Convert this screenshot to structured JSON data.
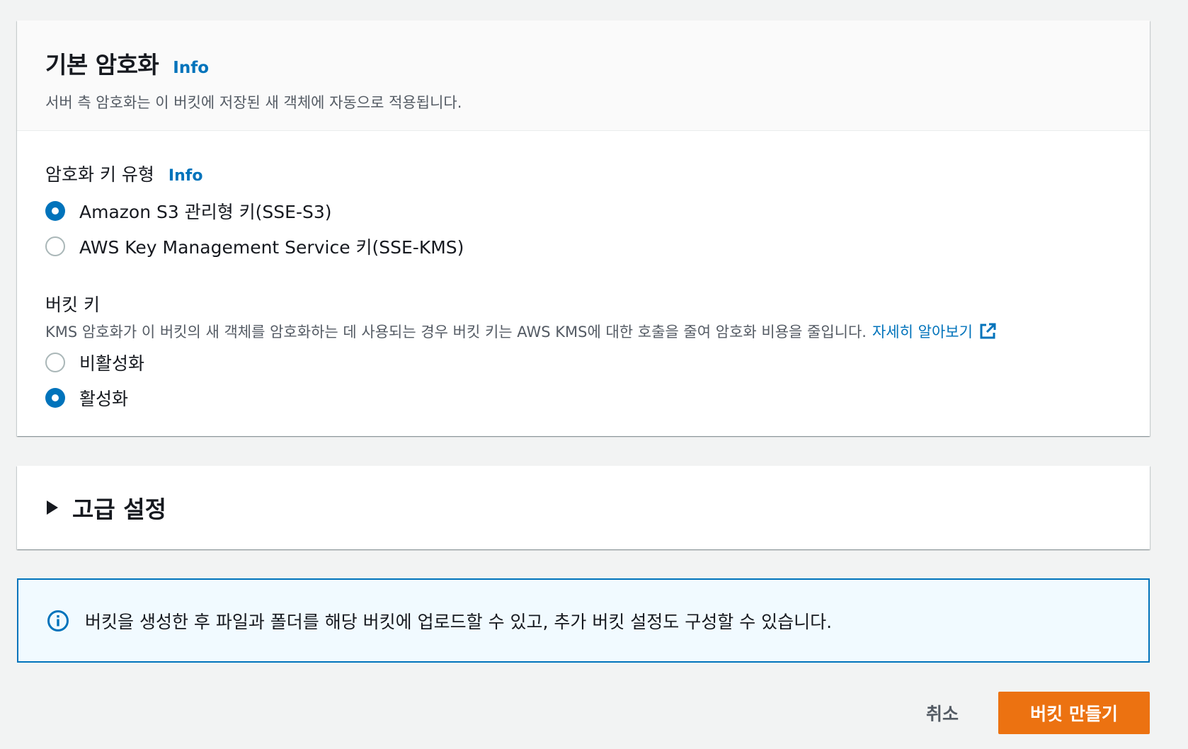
{
  "encryption": {
    "title": "기본 암호화",
    "info_label": "Info",
    "description": "서버 측 암호화는 이 버킷에 저장된 새 객체에 자동으로 적용됩니다.",
    "key_type": {
      "label": "암호화 키 유형",
      "info_label": "Info",
      "options": [
        {
          "label": "Amazon S3 관리형 키(SSE-S3)",
          "selected": true
        },
        {
          "label": "AWS Key Management Service 키(SSE-KMS)",
          "selected": false
        }
      ]
    },
    "bucket_key": {
      "label": "버킷 키",
      "description": "KMS 암호화가 이 버킷의 새 객체를 암호화하는 데 사용되는 경우 버킷 키는 AWS KMS에 대한 호출을 줄여 암호화 비용을 줄입니다.",
      "learn_more": "자세히 알아보기",
      "learn_more_icon": "external-link-icon",
      "options": [
        {
          "label": "비활성화",
          "selected": false
        },
        {
          "label": "활성화",
          "selected": true
        }
      ]
    }
  },
  "advanced": {
    "title": "고급 설정",
    "icon": "caret-right-icon"
  },
  "alert": {
    "icon": "info-circle-icon",
    "text": "버킷을 생성한 후 파일과 폴더를 해당 버킷에 업로드할 수 있고, 추가 버킷 설정도 구성할 수 있습니다."
  },
  "actions": {
    "cancel_label": "취소",
    "create_label": "버킷 만들기"
  },
  "colors": {
    "accent": "#0073bb",
    "primary_button": "#ec7211",
    "alert_background": "#f1faff"
  }
}
